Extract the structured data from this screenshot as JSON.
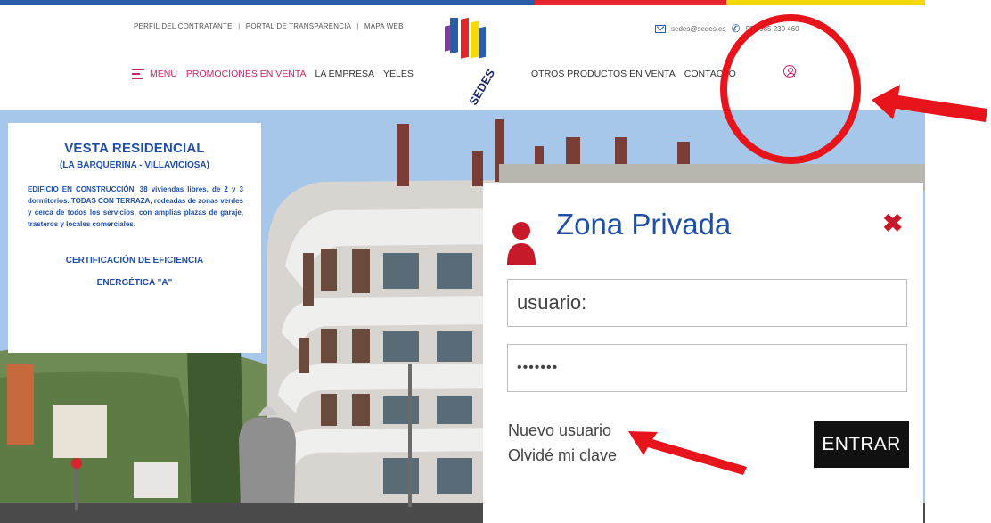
{
  "header": {
    "links": [
      "PERFIL DEL CONTRATANTE",
      "PORTAL DE TRANSPARENCIA",
      "MAPA WEB"
    ],
    "link_separator": "|",
    "contact_email": "sedes@sedes.es",
    "contact_phone": "984 985 230 460",
    "logo_text": "SEDES"
  },
  "nav": {
    "menu_label": "MENÚ",
    "promotions": "PROMOCIONES EN VENTA",
    "company": "LA EMPRESA",
    "yeles": "YELES",
    "other_products": "OTROS PRODUCTOS EN VENTA",
    "contact": "CONTACTO"
  },
  "info_card": {
    "title": "VESTA RESIDENCIAL",
    "subtitle": "(LA BARQUERINA - VILLAVICIOSA)",
    "body": "EDIFICIO EN CONSTRUCCIÓN, 38 viviendas libres, de 2 y 3 dormitorios. TODAS CON TERRAZA, rodeadas de zonas verdes y cerca de todos los servicios, con amplias plazas de garaje, trasteros y locales comerciales.",
    "cert_line1": "CERTIFICACIÓN DE EFICIENCIA",
    "cert_line2": "ENERGÉTICA \"A\""
  },
  "login_modal": {
    "title": "Zona Privada",
    "close_icon": "close-x-icon",
    "username_value": "usuario:",
    "password_value": "•••••••",
    "new_user_link": "Nuevo usuario",
    "forgot_link": "Olvidé mi clave",
    "submit_label": "ENTRAR"
  },
  "colors": {
    "brand_blue": "#1f4fa8",
    "accent_pink": "#c8266b",
    "close_red": "#c8192b",
    "annotation_red": "#e8141b",
    "stripe": [
      "#2a5da8",
      "#ffffff",
      "#e3262b",
      "#f5d90a"
    ]
  },
  "icons": [
    "mail-icon",
    "phone-icon",
    "hamburger-menu-icon",
    "user-circle-icon",
    "user-silhouette-icon",
    "close-x-icon"
  ]
}
